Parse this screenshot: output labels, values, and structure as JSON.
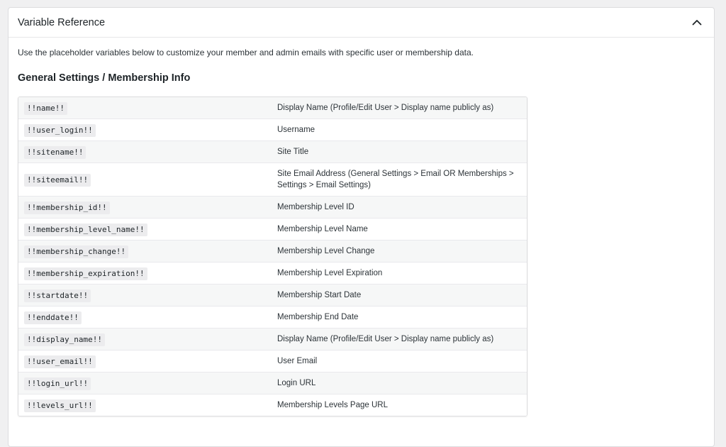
{
  "panel": {
    "title": "Variable Reference",
    "toggle_icon": "chevron-up-icon"
  },
  "intro": "Use the placeholder variables below to customize your member and admin emails with specific user or membership data.",
  "section_heading": "General Settings / Membership Info",
  "variables": [
    {
      "code": "!!name!!",
      "description": "Display Name (Profile/Edit User > Display name publicly as)"
    },
    {
      "code": "!!user_login!!",
      "description": "Username"
    },
    {
      "code": "!!sitename!!",
      "description": "Site Title"
    },
    {
      "code": "!!siteemail!!",
      "description": "Site Email Address (General Settings > Email OR Memberships > Settings > Email Settings)"
    },
    {
      "code": "!!membership_id!!",
      "description": "Membership Level ID"
    },
    {
      "code": "!!membership_level_name!!",
      "description": "Membership Level Name"
    },
    {
      "code": "!!membership_change!!",
      "description": "Membership Level Change"
    },
    {
      "code": "!!membership_expiration!!",
      "description": "Membership Level Expiration"
    },
    {
      "code": "!!startdate!!",
      "description": "Membership Start Date"
    },
    {
      "code": "!!enddate!!",
      "description": "Membership End Date"
    },
    {
      "code": "!!display_name!!",
      "description": "Display Name (Profile/Edit User > Display name publicly as)"
    },
    {
      "code": "!!user_email!!",
      "description": "User Email"
    },
    {
      "code": "!!login_url!!",
      "description": "Login URL"
    },
    {
      "code": "!!levels_url!!",
      "description": "Membership Levels Page URL"
    }
  ]
}
